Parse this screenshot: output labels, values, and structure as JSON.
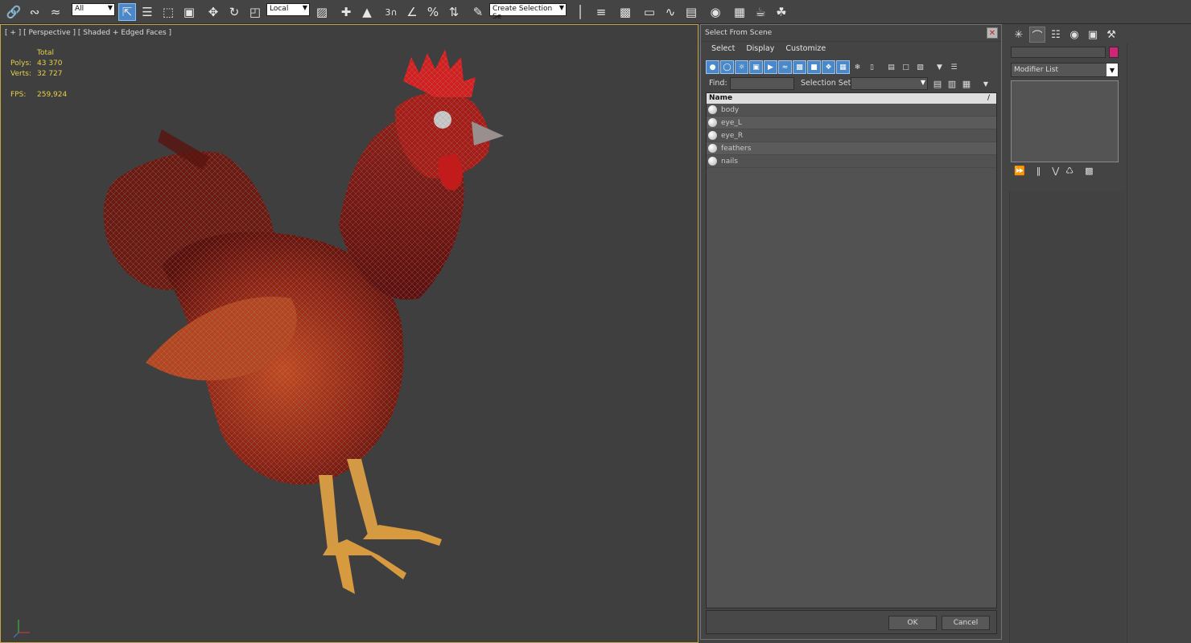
{
  "toolbar": {
    "selection_filter": "All",
    "coord_system": "Local",
    "snap_label": "3",
    "named_selection_placeholder": "Create Selection Se"
  },
  "viewport": {
    "label": "[ + ] [ Perspective ] [ Shaded + Edged Faces ]",
    "stats": {
      "header": "Total",
      "polys_label": "Polys:",
      "polys_value": "43 370",
      "verts_label": "Verts:",
      "verts_value": "32 727",
      "fps_label": "FPS:",
      "fps_value": "259,924"
    }
  },
  "dialog": {
    "title": "Select From Scene",
    "menu": [
      "Select",
      "Display",
      "Customize"
    ],
    "find_label": "Find:",
    "find_value": "",
    "selection_set_label": "Selection Set:",
    "selection_set_value": "",
    "column_header": "Name",
    "sort_indicator": "/",
    "objects": [
      "body",
      "eye_L",
      "eye_R",
      "feathers",
      "nails"
    ],
    "ok_label": "OK",
    "cancel_label": "Cancel"
  },
  "command_panel": {
    "object_name": "",
    "object_color": "#d2257a",
    "modifier_list_label": "Modifier List"
  }
}
